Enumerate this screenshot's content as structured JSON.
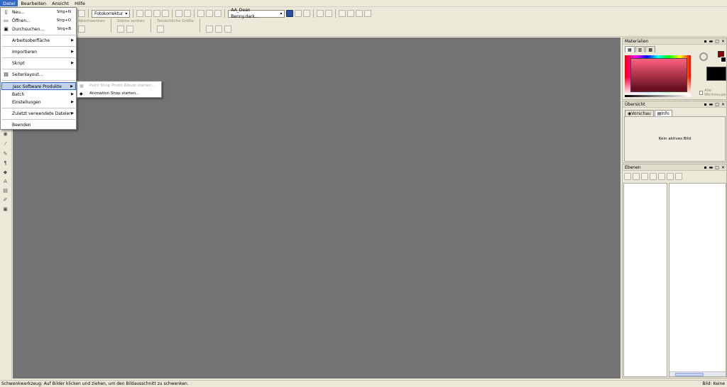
{
  "menubar": [
    "Datei",
    "Bearbeiten",
    "Ansicht",
    "Hilfe"
  ],
  "toolbar": {
    "fotokorrektur": "Fotokorrektur",
    "script_select": "AA_Dean Benny.dark...",
    "group1_label": "Abschwenken",
    "group2_label": "Stärke senken",
    "group3_label": "Tatsächliche Größe"
  },
  "file_menu": {
    "new": {
      "label": "Neu...",
      "shortcut": "Strg+N"
    },
    "open": {
      "label": "Öffnen...",
      "shortcut": "Strg+O"
    },
    "browse": {
      "label": "Durchsuchen...",
      "shortcut": "Strg+B"
    },
    "workspace": "Arbeitsoberfläche",
    "import": "Importieren",
    "script": "Skript",
    "page_setup": "Seitenlayout...",
    "jasc": "Jasc Software Produkte",
    "batch": "Batch",
    "settings": "Einstellungen",
    "recent": "Zuletzt verwendete Dateien",
    "exit": "Beenden"
  },
  "submenu": {
    "album": "Paint Shop Photo Album starten...",
    "animation": "Animation Shop starten..."
  },
  "panels": {
    "materials": {
      "title": "Materialien",
      "all_tools": "Alle Werkzeuge"
    },
    "overview": {
      "title": "Übersicht",
      "tab_preview": "Vorschau",
      "tab_info": "Info",
      "empty": "Kein aktives Bild"
    },
    "layers": {
      "title": "Ebenen"
    }
  },
  "status": {
    "left": "Schwenkwerkzeug: Auf Bilder klicken und ziehen, um den Bildausschnitt zu schwenken.",
    "right": "Bild: Keine"
  },
  "colors": {
    "foreground": "#8b0000",
    "background": "#000000",
    "canvas": "#737373",
    "menu_highlight": "#c1d2ee"
  }
}
